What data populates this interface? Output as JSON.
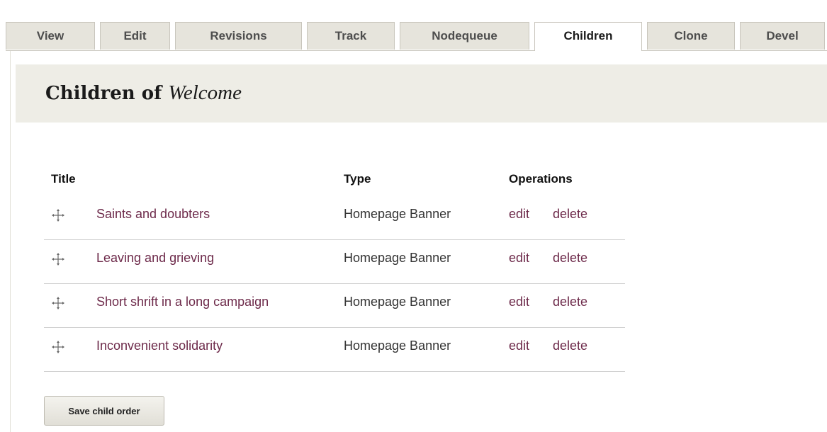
{
  "tabs": [
    {
      "label": "View",
      "active": false
    },
    {
      "label": "Edit",
      "active": false
    },
    {
      "label": "Revisions",
      "active": false
    },
    {
      "label": "Track",
      "active": false
    },
    {
      "label": "Nodequeue",
      "active": false
    },
    {
      "label": "Children",
      "active": true
    },
    {
      "label": "Clone",
      "active": false
    },
    {
      "label": "Devel",
      "active": false
    }
  ],
  "page": {
    "title_prefix": "Children of",
    "title_name": "Welcome"
  },
  "table": {
    "headers": {
      "title": "Title",
      "type": "Type",
      "operations": "Operations"
    },
    "rows": [
      {
        "title": "Saints and doubters",
        "type": "Homepage Banner",
        "edit": "edit",
        "delete": "delete"
      },
      {
        "title": "Leaving and grieving",
        "type": "Homepage Banner",
        "edit": "edit",
        "delete": "delete"
      },
      {
        "title": "Short shrift in a long campaign",
        "type": "Homepage Banner",
        "edit": "edit",
        "delete": "delete"
      },
      {
        "title": "Inconvenient solidarity",
        "type": "Homepage Banner",
        "edit": "edit",
        "delete": "delete"
      }
    ]
  },
  "actions": {
    "save_label": "Save child order"
  },
  "colors": {
    "link": "#6d2a4a",
    "title_band": "#eeede6",
    "tab_inactive": "#e6e4dc"
  },
  "icons": {
    "row_handle": "drag-handle-icon"
  }
}
